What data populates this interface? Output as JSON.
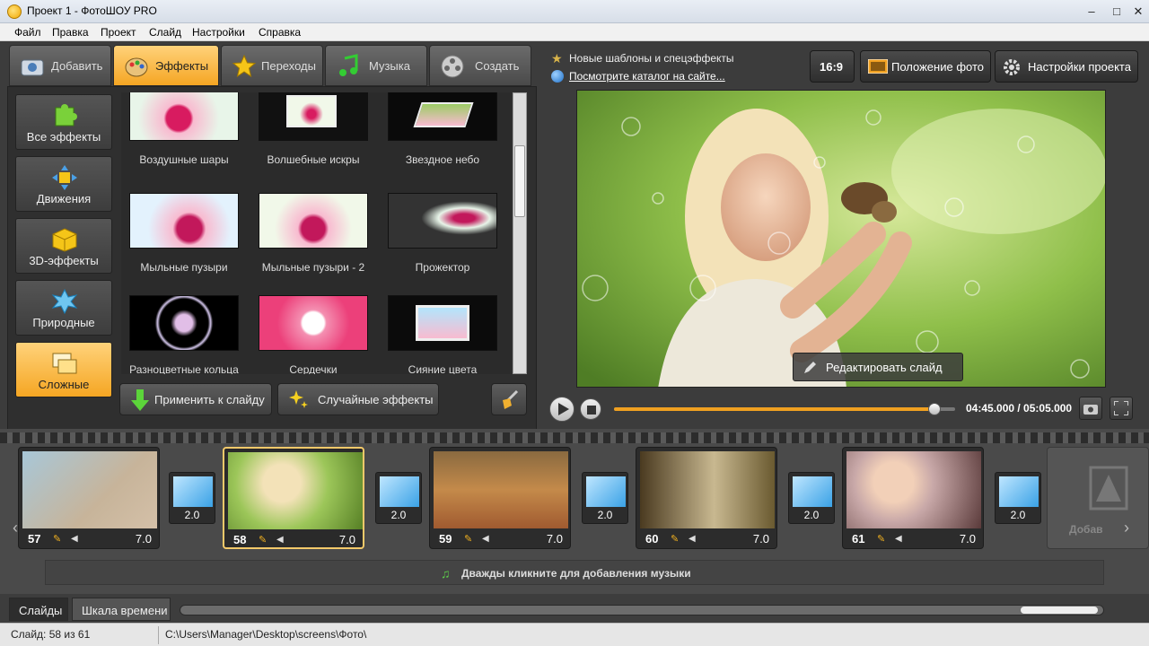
{
  "window": {
    "title": "Проект 1 - ФотоШОУ PRO",
    "min": "–",
    "max": "□",
    "close": "✕"
  },
  "menu": [
    "Файл",
    "Правка",
    "Проект",
    "Слайд",
    "Настройки",
    "Справка"
  ],
  "tabs": [
    {
      "label": "Добавить",
      "icon": "camera-icon"
    },
    {
      "label": "Эффекты",
      "icon": "palette-icon",
      "active": true
    },
    {
      "label": "Переходы",
      "icon": "star-icon"
    },
    {
      "label": "Музыка",
      "icon": "music-note-icon"
    },
    {
      "label": "Создать",
      "icon": "film-reel-icon"
    }
  ],
  "categories": [
    {
      "label": "Все эффекты",
      "icon": "puzzle-icon"
    },
    {
      "label": "Движения",
      "icon": "move-arrows-icon"
    },
    {
      "label": "3D-эффекты",
      "icon": "cube-icon"
    },
    {
      "label": "Природные",
      "icon": "snowflake-icon"
    },
    {
      "label": "Сложные",
      "icon": "layers-icon",
      "active": true
    }
  ],
  "effects": [
    {
      "label": "Воздушные шары"
    },
    {
      "label": "Волшебные искры"
    },
    {
      "label": "Звездное небо"
    },
    {
      "label": "Мыльные пузыри"
    },
    {
      "label": "Мыльные пузыри - 2"
    },
    {
      "label": "Прожектор"
    },
    {
      "label": "Разноцветные кольца"
    },
    {
      "label": "Сердечки"
    },
    {
      "label": "Сияние цвета"
    }
  ],
  "actions": {
    "apply": "Применить к слайду",
    "random": "Случайные эффекты"
  },
  "promo": {
    "text": "Новые шаблоны и спецэффекты",
    "link": "Посмотрите каталог на сайте..."
  },
  "toolbar": {
    "ratio": "16:9",
    "photo_position": "Положение фото",
    "project_settings": "Настройки проекта"
  },
  "preview": {
    "edit_slide": "Редактировать слайд"
  },
  "player": {
    "timecode": "04:45.000 / 05:05.000",
    "progress": 0.94
  },
  "slides": [
    {
      "num": "57",
      "duration": "7.0"
    },
    {
      "num": "58",
      "duration": "7.0",
      "selected": true
    },
    {
      "num": "59",
      "duration": "7.0"
    },
    {
      "num": "60",
      "duration": "7.0"
    },
    {
      "num": "61",
      "duration": "7.0"
    }
  ],
  "transitions": [
    "2.0",
    "2.0",
    "2.0",
    "2.0",
    "2.0"
  ],
  "add_slot": "Добав",
  "music_hint": "Дважды кликните для добавления музыки",
  "bottom_tabs": {
    "slides": "Слайды",
    "timeline": "Шкала времени"
  },
  "status": {
    "slide_count": "Слайд: 58 из 61",
    "path": "C:\\Users\\Manager\\Desktop\\screens\\Фото\\"
  }
}
